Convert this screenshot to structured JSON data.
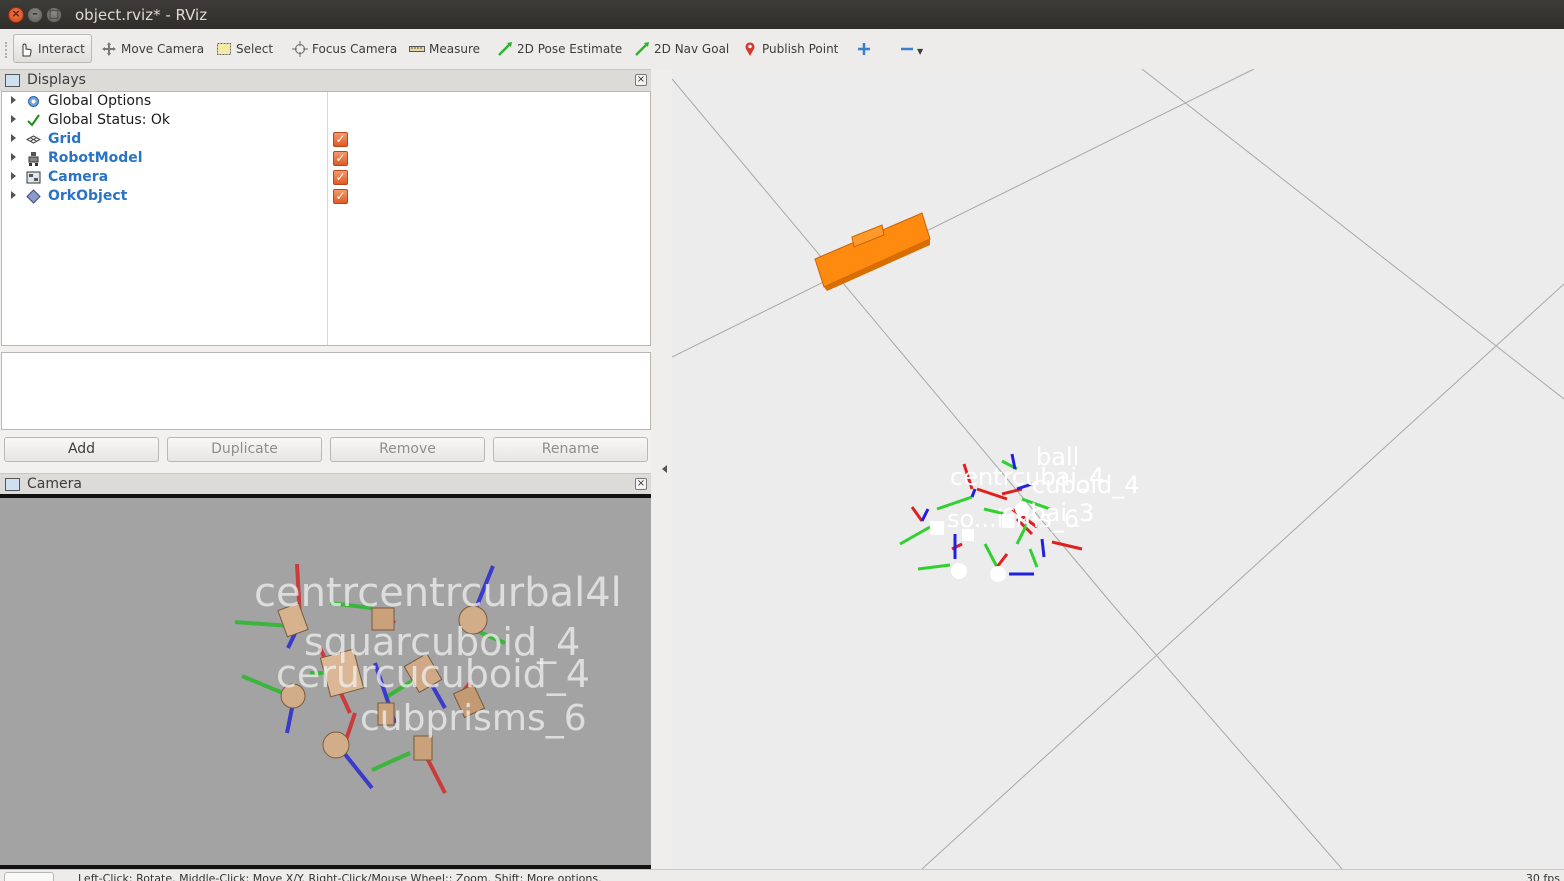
{
  "window": {
    "title": "object.rviz* - RViz"
  },
  "toolbar": {
    "tools": [
      {
        "label": "Interact",
        "icon": "hand-pointer-icon",
        "active": true
      },
      {
        "label": "Move Camera",
        "icon": "move-camera-icon"
      },
      {
        "label": "Select",
        "icon": "select-box-icon"
      },
      {
        "label": "Focus Camera",
        "icon": "focus-camera-icon"
      },
      {
        "label": "Measure",
        "icon": "ruler-icon"
      },
      {
        "label": "2D Pose Estimate",
        "icon": "green-arrow-icon"
      },
      {
        "label": "2D Nav Goal",
        "icon": "green-arrow-icon"
      },
      {
        "label": "Publish Point",
        "icon": "map-pin-icon"
      }
    ],
    "add_tool": "plus-icon",
    "remove_tool": "minus-icon"
  },
  "displays_panel": {
    "title": "Displays",
    "items": [
      {
        "label": "Global Options",
        "icon": "gear-icon",
        "checked": null
      },
      {
        "label": "Global Status: Ok",
        "icon": "checkmark-icon",
        "checked": null
      },
      {
        "label": "Grid",
        "icon": "grid-icon",
        "checked": true
      },
      {
        "label": "RobotModel",
        "icon": "robot-icon",
        "checked": true
      },
      {
        "label": "Camera",
        "icon": "camera-icon",
        "checked": true
      },
      {
        "label": "OrkObject",
        "icon": "diamond-icon",
        "checked": true
      }
    ],
    "buttons": {
      "add": "Add",
      "duplicate": "Duplicate",
      "remove": "Remove",
      "rename": "Rename"
    }
  },
  "camera_panel": {
    "title": "Camera",
    "overlay_labels": [
      "centrcentrcurbal4l",
      "squarcuboid_4",
      "cerurcucuboid_4",
      "cubprisms_6"
    ]
  },
  "viewport": {
    "labels": [
      "ball",
      "centrcubai_4",
      "cuboid_4",
      "so...isms_6",
      "cubai_3"
    ]
  },
  "statusbar": {
    "text": "Left-Click: Rotate.  Middle-Click: Move X/Y.  Right-Click/Mouse Wheel:: Zoom.  Shift: More options.",
    "fps": "30 fps"
  }
}
